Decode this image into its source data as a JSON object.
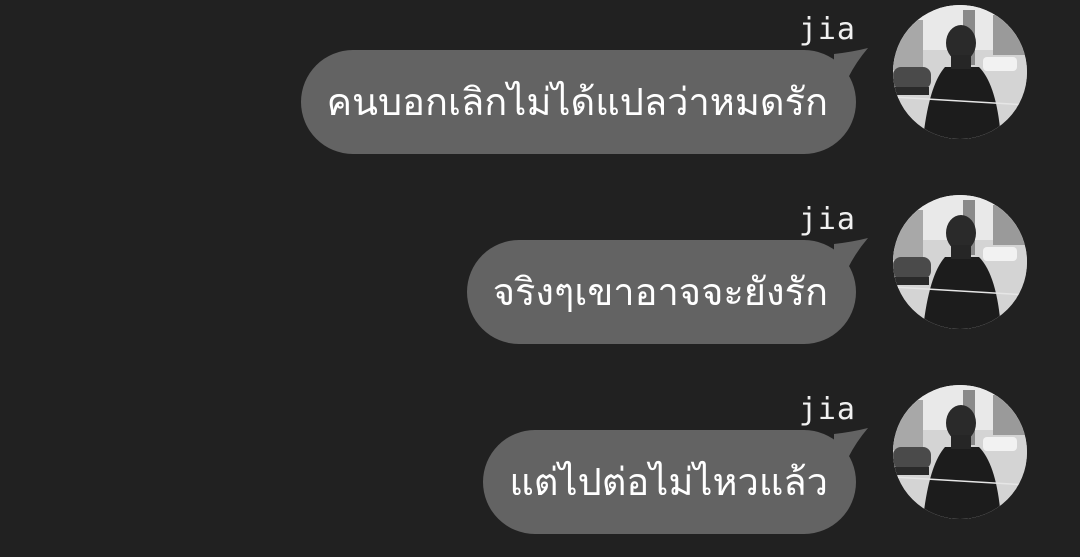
{
  "chat": {
    "messages": [
      {
        "sender": "jia",
        "text": "คนบอกเลิกไม่ได้แปลว่าหมดรัก",
        "avatar_icon": "user-avatar-photo"
      },
      {
        "sender": "jia",
        "text": "จริงๆเขาอาจจะยังรัก",
        "avatar_icon": "user-avatar-photo"
      },
      {
        "sender": "jia",
        "text": "แต่ไปต่อไม่ไหวแล้ว",
        "avatar_icon": "user-avatar-photo"
      }
    ]
  },
  "colors": {
    "background": "#212121",
    "bubble": "#636363",
    "text": "#ffffff",
    "sender_name": "#f0f0f0"
  }
}
